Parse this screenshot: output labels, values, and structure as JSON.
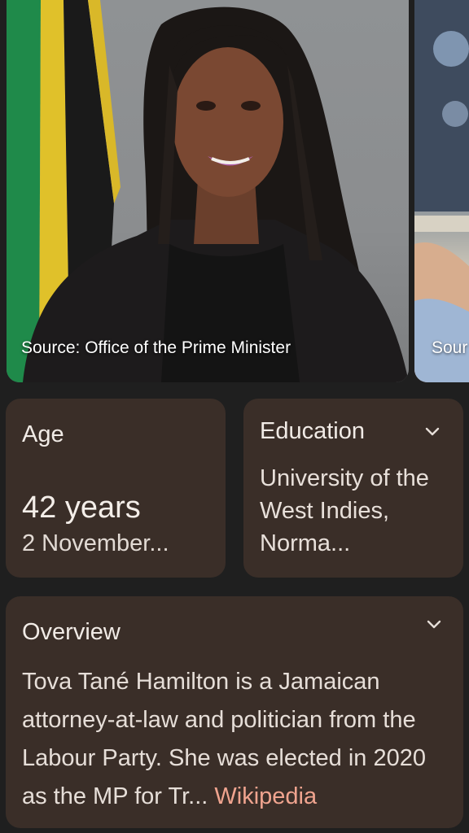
{
  "images": [
    {
      "caption": "Source: Office of the Prime Minister"
    },
    {
      "caption": "Sour"
    }
  ],
  "age_card": {
    "title": "Age",
    "value": "42 years",
    "subtext": "2 November..."
  },
  "education_card": {
    "title": "Education",
    "value": "University of the West Indies, Norma...",
    "icon": "chevron-down-icon"
  },
  "overview_card": {
    "title": "Overview",
    "text": "Tova Tané Hamilton is a Jamaican attorney-at-law and politician from the Labour Party. She was elected in 2020 as the MP for Tr...",
    "link_label": "Wikipedia",
    "icon": "chevron-down-icon"
  },
  "colors": {
    "background": "#1f1f1f",
    "card": "#3a2e28",
    "link": "#f0a48f"
  }
}
